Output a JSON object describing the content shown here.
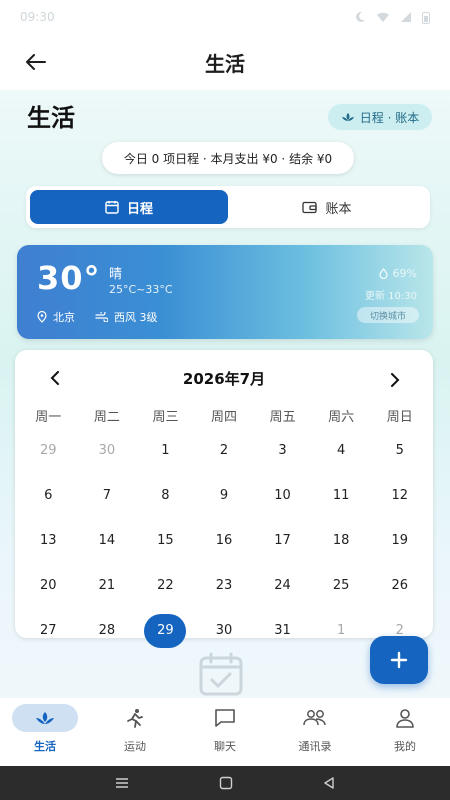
{
  "status_bar": {
    "time": "09:30"
  },
  "app_bar": {
    "title": "生活"
  },
  "page": {
    "title": "生活",
    "mode_chip": "日程 · 账本"
  },
  "summary": "今日 0 项日程 · 本月支出 ¥0 · 结余 ¥0",
  "tabs": [
    {
      "label": "日程",
      "icon": "calendar-icon",
      "active": true
    },
    {
      "label": "账本",
      "icon": "wallet-icon",
      "active": false
    }
  ],
  "weather": {
    "temp": "30°",
    "condition": "晴",
    "range": "25°C~33°C",
    "location": "北京",
    "wind": "西风 3级",
    "humidity": "69%",
    "updated": "更新 10:30",
    "switch": "切换城市"
  },
  "calendar": {
    "month": "2026年7月",
    "weekdays": [
      "周一",
      "周二",
      "周三",
      "周四",
      "周五",
      "周六",
      "周日"
    ],
    "days": [
      {
        "d": "29",
        "muted": true
      },
      {
        "d": "30",
        "muted": true
      },
      {
        "d": "1"
      },
      {
        "d": "2"
      },
      {
        "d": "3"
      },
      {
        "d": "4"
      },
      {
        "d": "5"
      },
      {
        "d": "6"
      },
      {
        "d": "7"
      },
      {
        "d": "8"
      },
      {
        "d": "9"
      },
      {
        "d": "10"
      },
      {
        "d": "11"
      },
      {
        "d": "12"
      },
      {
        "d": "13"
      },
      {
        "d": "14"
      },
      {
        "d": "15"
      },
      {
        "d": "16"
      },
      {
        "d": "17"
      },
      {
        "d": "18"
      },
      {
        "d": "19"
      },
      {
        "d": "20"
      },
      {
        "d": "21"
      },
      {
        "d": "22"
      },
      {
        "d": "23"
      },
      {
        "d": "24"
      },
      {
        "d": "25"
      },
      {
        "d": "26"
      },
      {
        "d": "27"
      },
      {
        "d": "28"
      },
      {
        "d": "29",
        "today": true
      },
      {
        "d": "30"
      },
      {
        "d": "31"
      },
      {
        "d": "1",
        "muted": true
      },
      {
        "d": "2",
        "muted": true
      }
    ]
  },
  "bottom_nav": [
    {
      "label": "生活",
      "icon": "leaf-icon",
      "active": true
    },
    {
      "label": "运动",
      "icon": "runner-icon"
    },
    {
      "label": "聊天",
      "icon": "chat-icon"
    },
    {
      "label": "通讯录",
      "icon": "contacts-icon"
    },
    {
      "label": "我的",
      "icon": "profile-icon"
    }
  ],
  "colors": {
    "primary": "#1565c0",
    "chip_bg": "#cdeef0",
    "nav_active_bg": "#cfe0f3"
  }
}
